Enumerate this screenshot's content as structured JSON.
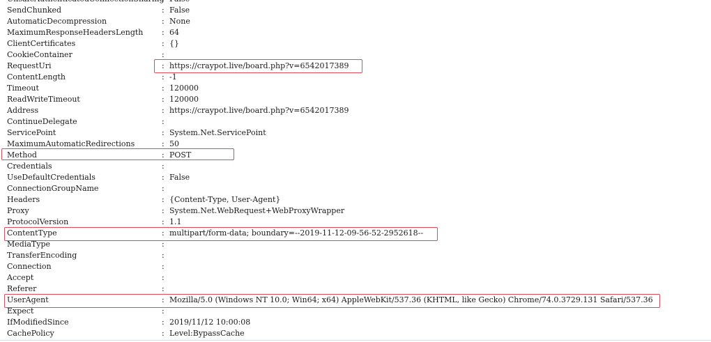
{
  "properties": [
    {
      "name": "UnsafeAuthenticatedConnectionSharing",
      "value": "False"
    },
    {
      "name": "SendChunked",
      "value": "False"
    },
    {
      "name": "AutomaticDecompression",
      "value": "None"
    },
    {
      "name": "MaximumResponseHeadersLength",
      "value": "64"
    },
    {
      "name": "ClientCertificates",
      "value": "{}"
    },
    {
      "name": "CookieContainer",
      "value": ""
    },
    {
      "name": "RequestUri",
      "value": "https://craypot.live/board.php?v=6542017389",
      "highlight": true
    },
    {
      "name": "ContentLength",
      "value": "-1"
    },
    {
      "name": "Timeout",
      "value": "120000"
    },
    {
      "name": "ReadWriteTimeout",
      "value": "120000"
    },
    {
      "name": "Address",
      "value": "https://craypot.live/board.php?v=6542017389"
    },
    {
      "name": "ContinueDelegate",
      "value": ""
    },
    {
      "name": "ServicePoint",
      "value": "System.Net.ServicePoint"
    },
    {
      "name": "MaximumAutomaticRedirections",
      "value": "50"
    },
    {
      "name": "Method",
      "value": "POST",
      "highlight": true
    },
    {
      "name": "Credentials",
      "value": ""
    },
    {
      "name": "UseDefaultCredentials",
      "value": "False"
    },
    {
      "name": "ConnectionGroupName",
      "value": ""
    },
    {
      "name": "Headers",
      "value": "{Content-Type, User-Agent}"
    },
    {
      "name": "Proxy",
      "value": "System.Net.WebRequest+WebProxyWrapper"
    },
    {
      "name": "ProtocolVersion",
      "value": "1.1"
    },
    {
      "name": "ContentType",
      "value": "multipart/form-data; boundary=--2019-11-12-09-56-52-2952618--",
      "highlight": true
    },
    {
      "name": "MediaType",
      "value": ""
    },
    {
      "name": "TransferEncoding",
      "value": ""
    },
    {
      "name": "Connection",
      "value": ""
    },
    {
      "name": "Accept",
      "value": ""
    },
    {
      "name": "Referer",
      "value": ""
    },
    {
      "name": "UserAgent",
      "value": "Mozilla/5.0 (Windows NT 10.0; Win64; x64) AppleWebKit/537.36 (KHTML, like Gecko) Chrome/74.0.3729.131 Safari/537.36",
      "highlight": true
    },
    {
      "name": "Expect",
      "value": ""
    },
    {
      "name": "IfModifiedSince",
      "value": "2019/11/12 10:00:08"
    },
    {
      "name": "CachePolicy",
      "value": "Level:BypassCache"
    }
  ],
  "separator": ":",
  "highlight_color": "#e24a55"
}
